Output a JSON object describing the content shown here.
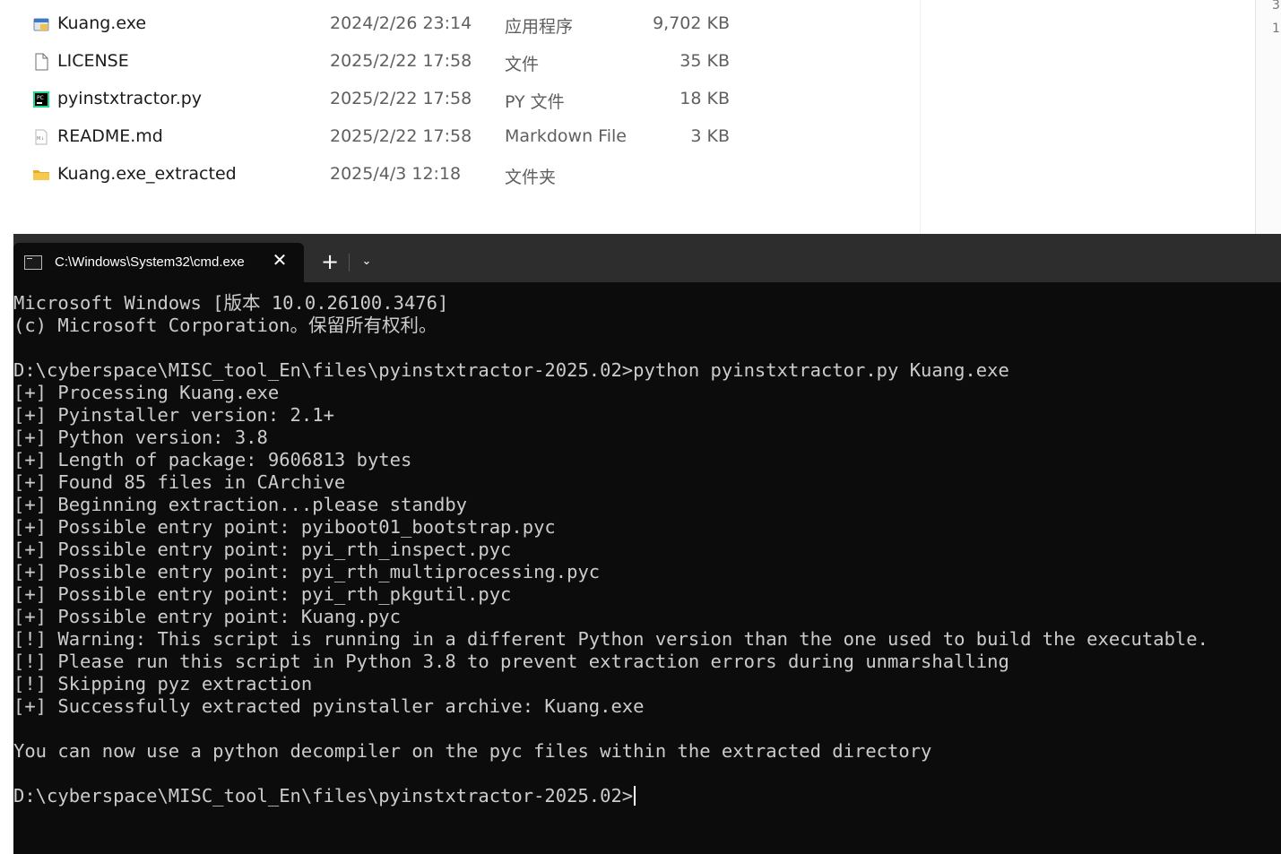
{
  "explorer": {
    "files": [
      {
        "name": "Kuang.exe",
        "date": "2024/2/26 23:14",
        "type": "应用程序",
        "size": "9,702 KB",
        "icon": "exe-icon"
      },
      {
        "name": "LICENSE",
        "date": "2025/2/22 17:58",
        "type": "文件",
        "size": "35 KB",
        "icon": "file-icon"
      },
      {
        "name": "pyinstxtractor.py",
        "date": "2025/2/22 17:58",
        "type": "PY 文件",
        "size": "18 KB",
        "icon": "pycharm-icon"
      },
      {
        "name": "README.md",
        "date": "2025/2/22 17:58",
        "type": "Markdown File",
        "size": "3 KB",
        "icon": "markdown-icon"
      },
      {
        "name": "Kuang.exe_extracted",
        "date": "2025/4/3 12:18",
        "type": "文件夹",
        "size": "",
        "icon": "folder-icon"
      }
    ],
    "right_edge_text": [
      "3",
      "1"
    ]
  },
  "terminal": {
    "tab_title": "C:\\Windows\\System32\\cmd.exe",
    "close_glyph": "✕",
    "new_tab_glyph": "+",
    "dropdown_glyph": "⌄",
    "lines": [
      "Microsoft Windows [版本 10.0.26100.3476]",
      "(c) Microsoft Corporation。保留所有权利。",
      "",
      "D:\\cyberspace\\MISC_tool_En\\files\\pyinstxtractor-2025.02>python pyinstxtractor.py Kuang.exe",
      "[+] Processing Kuang.exe",
      "[+] Pyinstaller version: 2.1+",
      "[+] Python version: 3.8",
      "[+] Length of package: 9606813 bytes",
      "[+] Found 85 files in CArchive",
      "[+] Beginning extraction...please standby",
      "[+] Possible entry point: pyiboot01_bootstrap.pyc",
      "[+] Possible entry point: pyi_rth_inspect.pyc",
      "[+] Possible entry point: pyi_rth_multiprocessing.pyc",
      "[+] Possible entry point: pyi_rth_pkgutil.pyc",
      "[+] Possible entry point: Kuang.pyc",
      "[!] Warning: This script is running in a different Python version than the one used to build the executable.",
      "[!] Please run this script in Python 3.8 to prevent extraction errors during unmarshalling",
      "[!] Skipping pyz extraction",
      "[+] Successfully extracted pyinstaller archive: Kuang.exe",
      "",
      "You can now use a python decompiler on the pyc files within the extracted directory",
      ""
    ],
    "prompt": "D:\\cyberspace\\MISC_tool_En\\files\\pyinstxtractor-2025.02>"
  },
  "colors": {
    "terminal_bg": "#0c0c0c",
    "terminal_text": "#cccccc",
    "tabbar_bg": "#2d2d2d",
    "folder": "#f2c04c"
  }
}
